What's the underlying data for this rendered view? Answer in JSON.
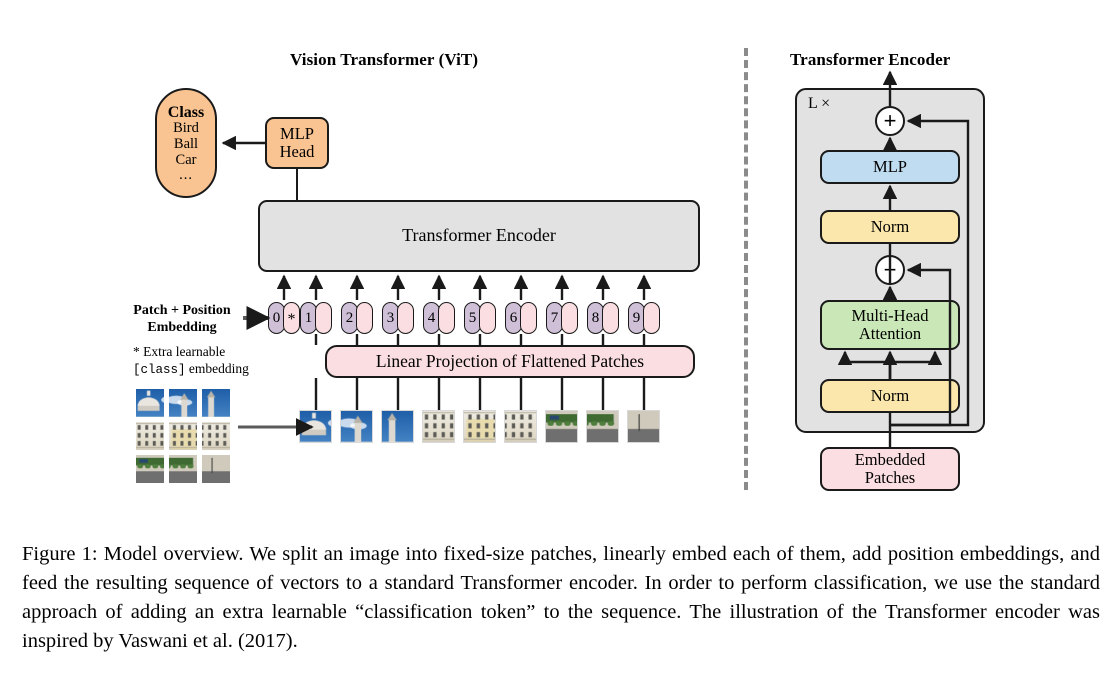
{
  "figure": {
    "left_panel_title": "Vision Transformer (ViT)",
    "right_panel_title": "Transformer Encoder",
    "caption": "Figure 1: Model overview. We split an image into fixed-size patches, linearly embed each of them, add position embeddings, and feed the resulting sequence of vectors to a standard Transformer encoder. In order to perform classification, we use the standard approach of adding an extra learnable “classification token” to the sequence. The illustration of the Transformer encoder was inspired by Vaswani et al. (2017)."
  },
  "vit": {
    "class_box": {
      "title": "Class",
      "items": [
        "Bird",
        "Ball",
        "Car"
      ],
      "ellipsis": "...",
      "color": "#f9c491"
    },
    "mlp_head": {
      "line1": "MLP",
      "line2": "Head",
      "color": "#f9c491"
    },
    "transformer_encoder": {
      "label": "Transformer Encoder",
      "color": "#e2e2e2"
    },
    "linear_projection": {
      "label": "Linear Projection of Flattened Patches",
      "color": "#fadee1"
    },
    "embedding_label": {
      "line1": "Patch + Position",
      "line2": "Embedding"
    },
    "embedding_note": {
      "line1_prefix": "* Extra learnable",
      "line2_mono": "[class]",
      "line2_suffix": " embedding"
    },
    "tokens": [
      {
        "position": "0",
        "extra": "*",
        "has_patch_source": false
      },
      {
        "position": "1",
        "extra": "",
        "has_patch_source": true
      },
      {
        "position": "2",
        "extra": "",
        "has_patch_source": true
      },
      {
        "position": "3",
        "extra": "",
        "has_patch_source": true
      },
      {
        "position": "4",
        "extra": "",
        "has_patch_source": true
      },
      {
        "position": "5",
        "extra": "",
        "has_patch_source": true
      },
      {
        "position": "6",
        "extra": "",
        "has_patch_source": true
      },
      {
        "position": "7",
        "extra": "",
        "has_patch_source": true
      },
      {
        "position": "8",
        "extra": "",
        "has_patch_source": true
      },
      {
        "position": "9",
        "extra": "",
        "has_patch_source": true
      }
    ],
    "position_pill_color": "#cfc0d8",
    "patch_pill_color": "#fadee1",
    "source_image_grid": {
      "rows": 3,
      "cols": 3,
      "description": "palace facade photo split into 9 patches"
    },
    "patch_count": 9
  },
  "encoder": {
    "repeat_label": "L ×",
    "blocks": [
      {
        "name": "mlp",
        "label": "MLP",
        "color": "#bfdcf0"
      },
      {
        "name": "norm-top",
        "label": "Norm",
        "color": "#fbe7ab"
      },
      {
        "name": "multi-head-attention",
        "line1": "Multi-Head",
        "line2": "Attention",
        "color": "#c9e7b7"
      },
      {
        "name": "norm-bottom",
        "label": "Norm",
        "color": "#fbe7ab"
      },
      {
        "name": "embedded-patches",
        "line1": "Embedded",
        "line2": "Patches",
        "color": "#fadee1"
      }
    ],
    "residual_symbol": "+",
    "outer_color": "#e2e2e2"
  }
}
